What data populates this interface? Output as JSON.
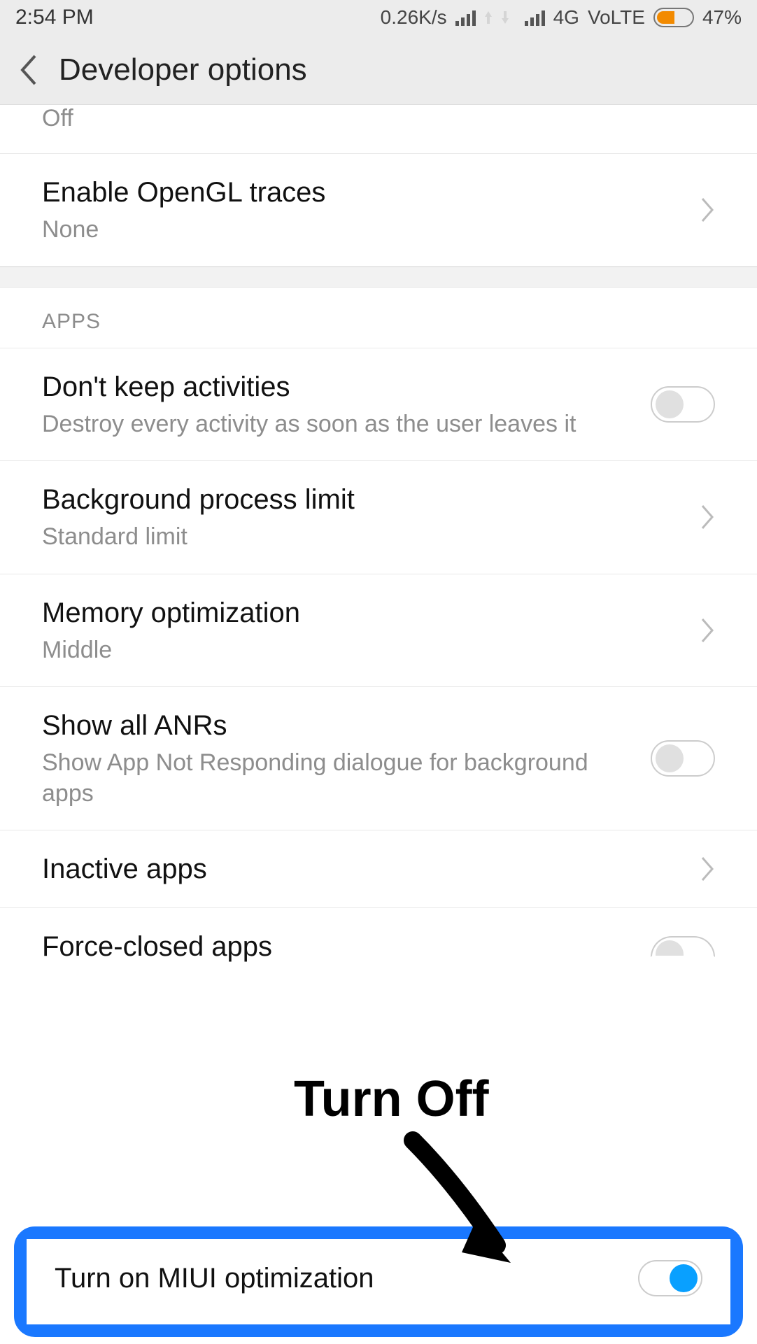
{
  "status": {
    "time": "2:54 PM",
    "net_speed": "0.26K/s",
    "net_label_1": "4G",
    "net_label_2": "VoLTE",
    "battery_pct": "47%"
  },
  "header": {
    "title": "Developer options"
  },
  "rows": {
    "partial_top_sub": "Off",
    "opengl": {
      "title": "Enable OpenGL traces",
      "sub": "None"
    },
    "apps_header": "APPS",
    "dont_keep": {
      "title": "Don't keep activities",
      "sub": "Destroy every activity as soon as the user leaves it"
    },
    "bg_limit": {
      "title": "Background process limit",
      "sub": "Standard limit"
    },
    "mem_opt": {
      "title": "Memory optimization",
      "sub": "Middle"
    },
    "anrs": {
      "title": "Show all ANRs",
      "sub": "Show App Not Responding dialogue for background apps"
    },
    "inactive": {
      "title": "Inactive apps"
    },
    "force_closed": {
      "title": "Force-closed apps"
    },
    "miui": {
      "title": "Turn on MIUI optimization"
    }
  },
  "annotation": {
    "text": "Turn Off"
  }
}
